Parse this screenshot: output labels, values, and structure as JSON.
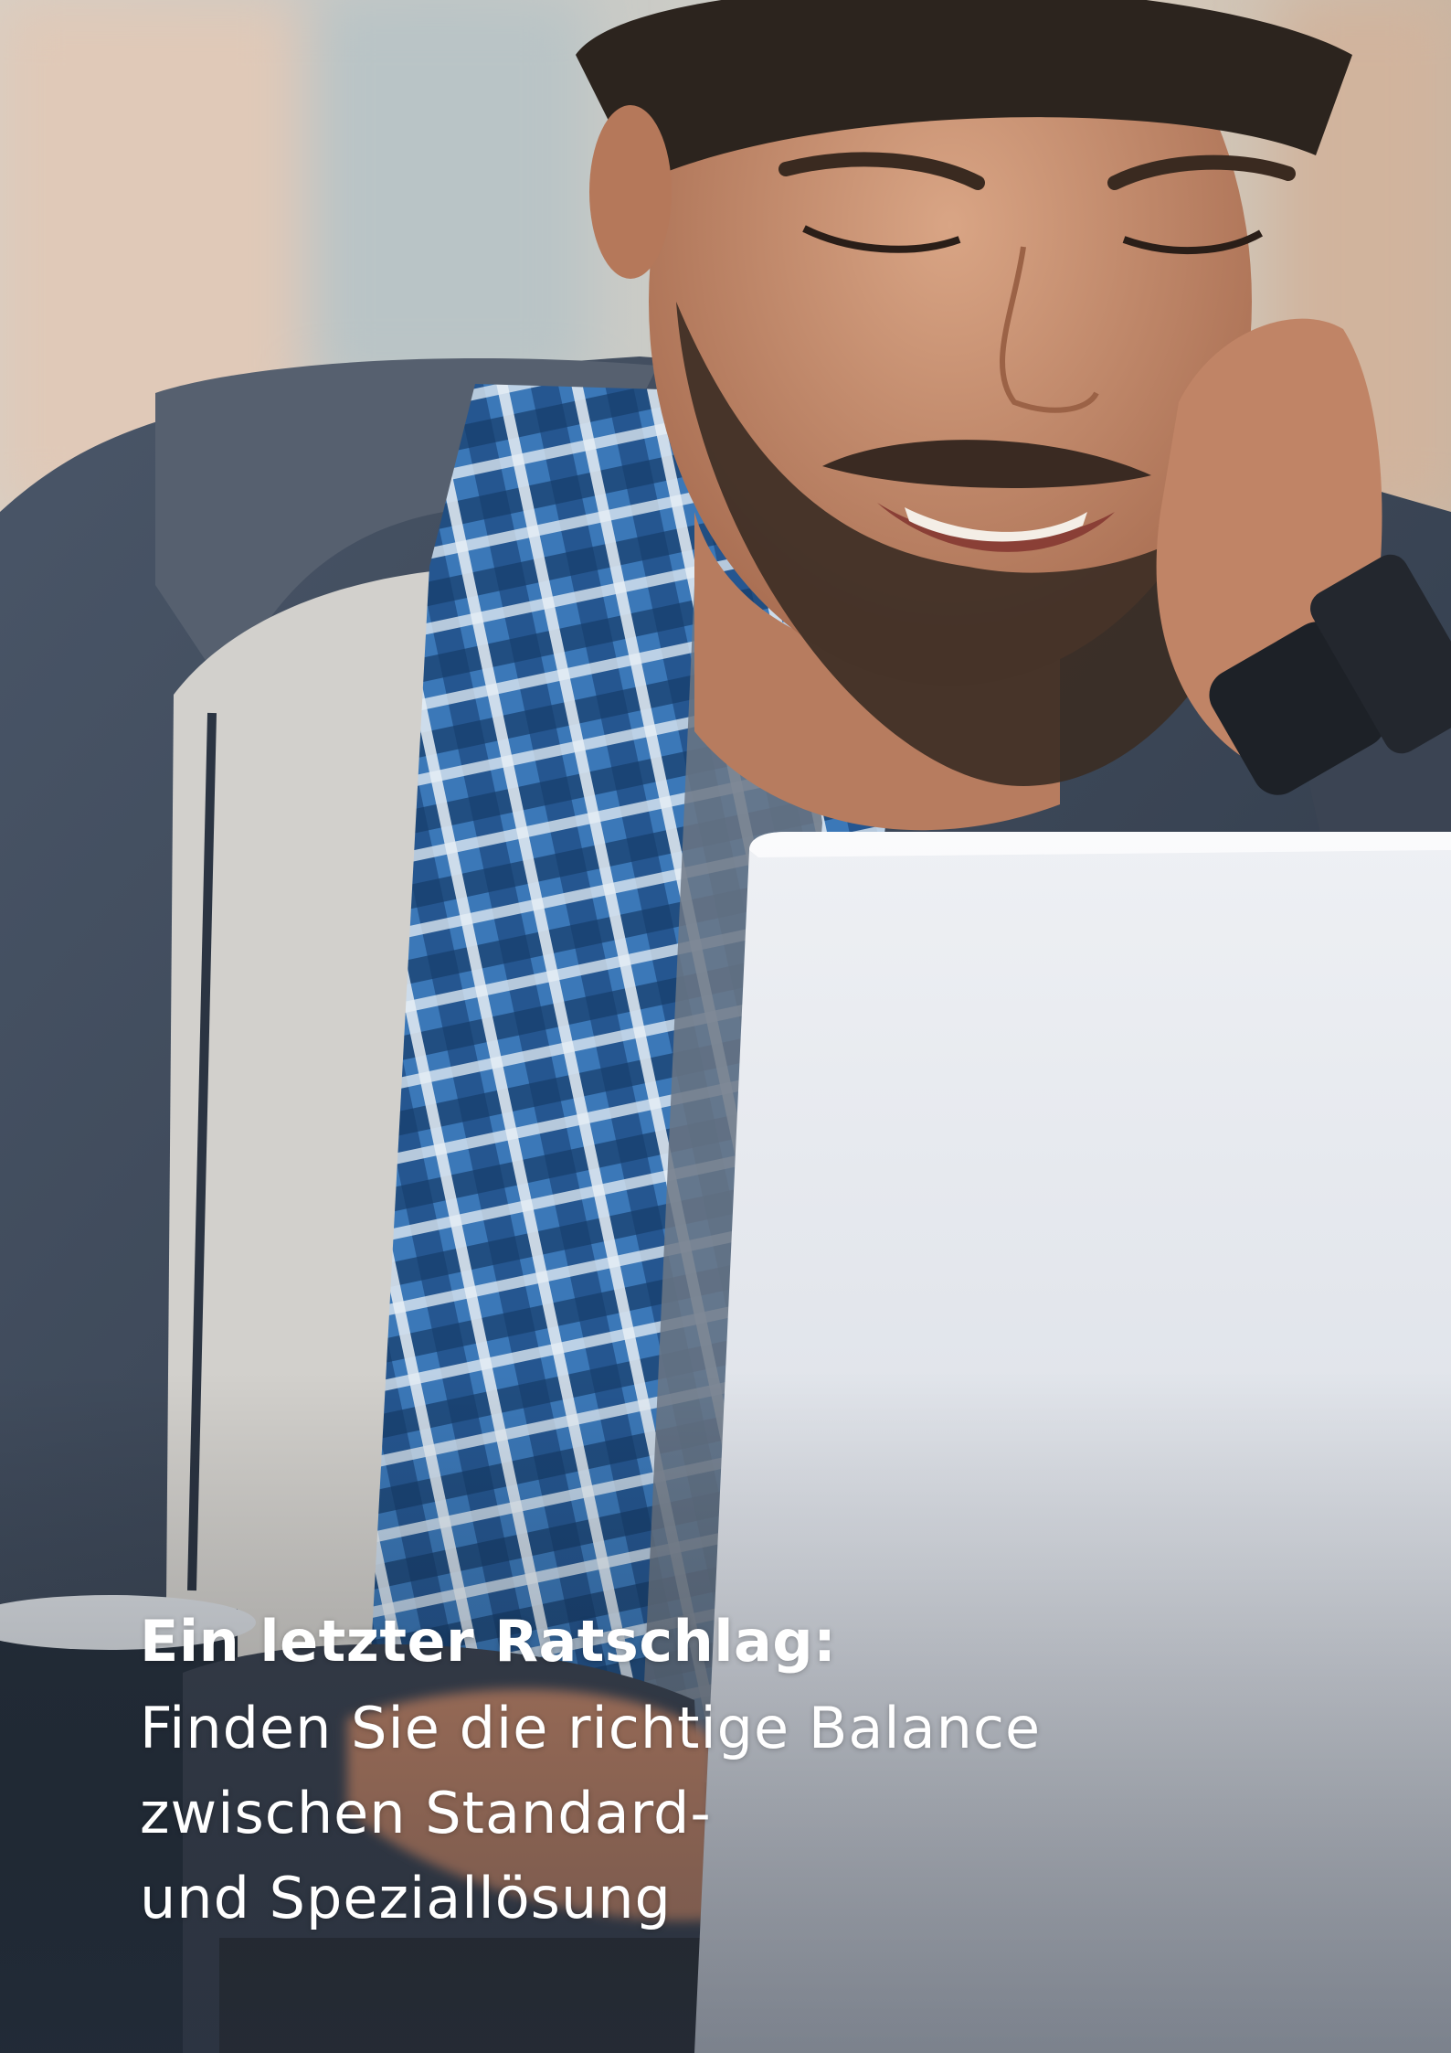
{
  "caption": {
    "headline": "Ein letzter Ratschlag:",
    "lines": [
      "Finden Sie die richtige Balance",
      "zwischen Standard-",
      "und Speziallösung"
    ]
  },
  "colors": {
    "background_blur": "#c9c3ba",
    "jacket": "#3a4657",
    "shirt_blue": "#2f6fb0",
    "skin": "#c99474",
    "laptop": "#dfe3ea",
    "text": "#ffffff"
  }
}
